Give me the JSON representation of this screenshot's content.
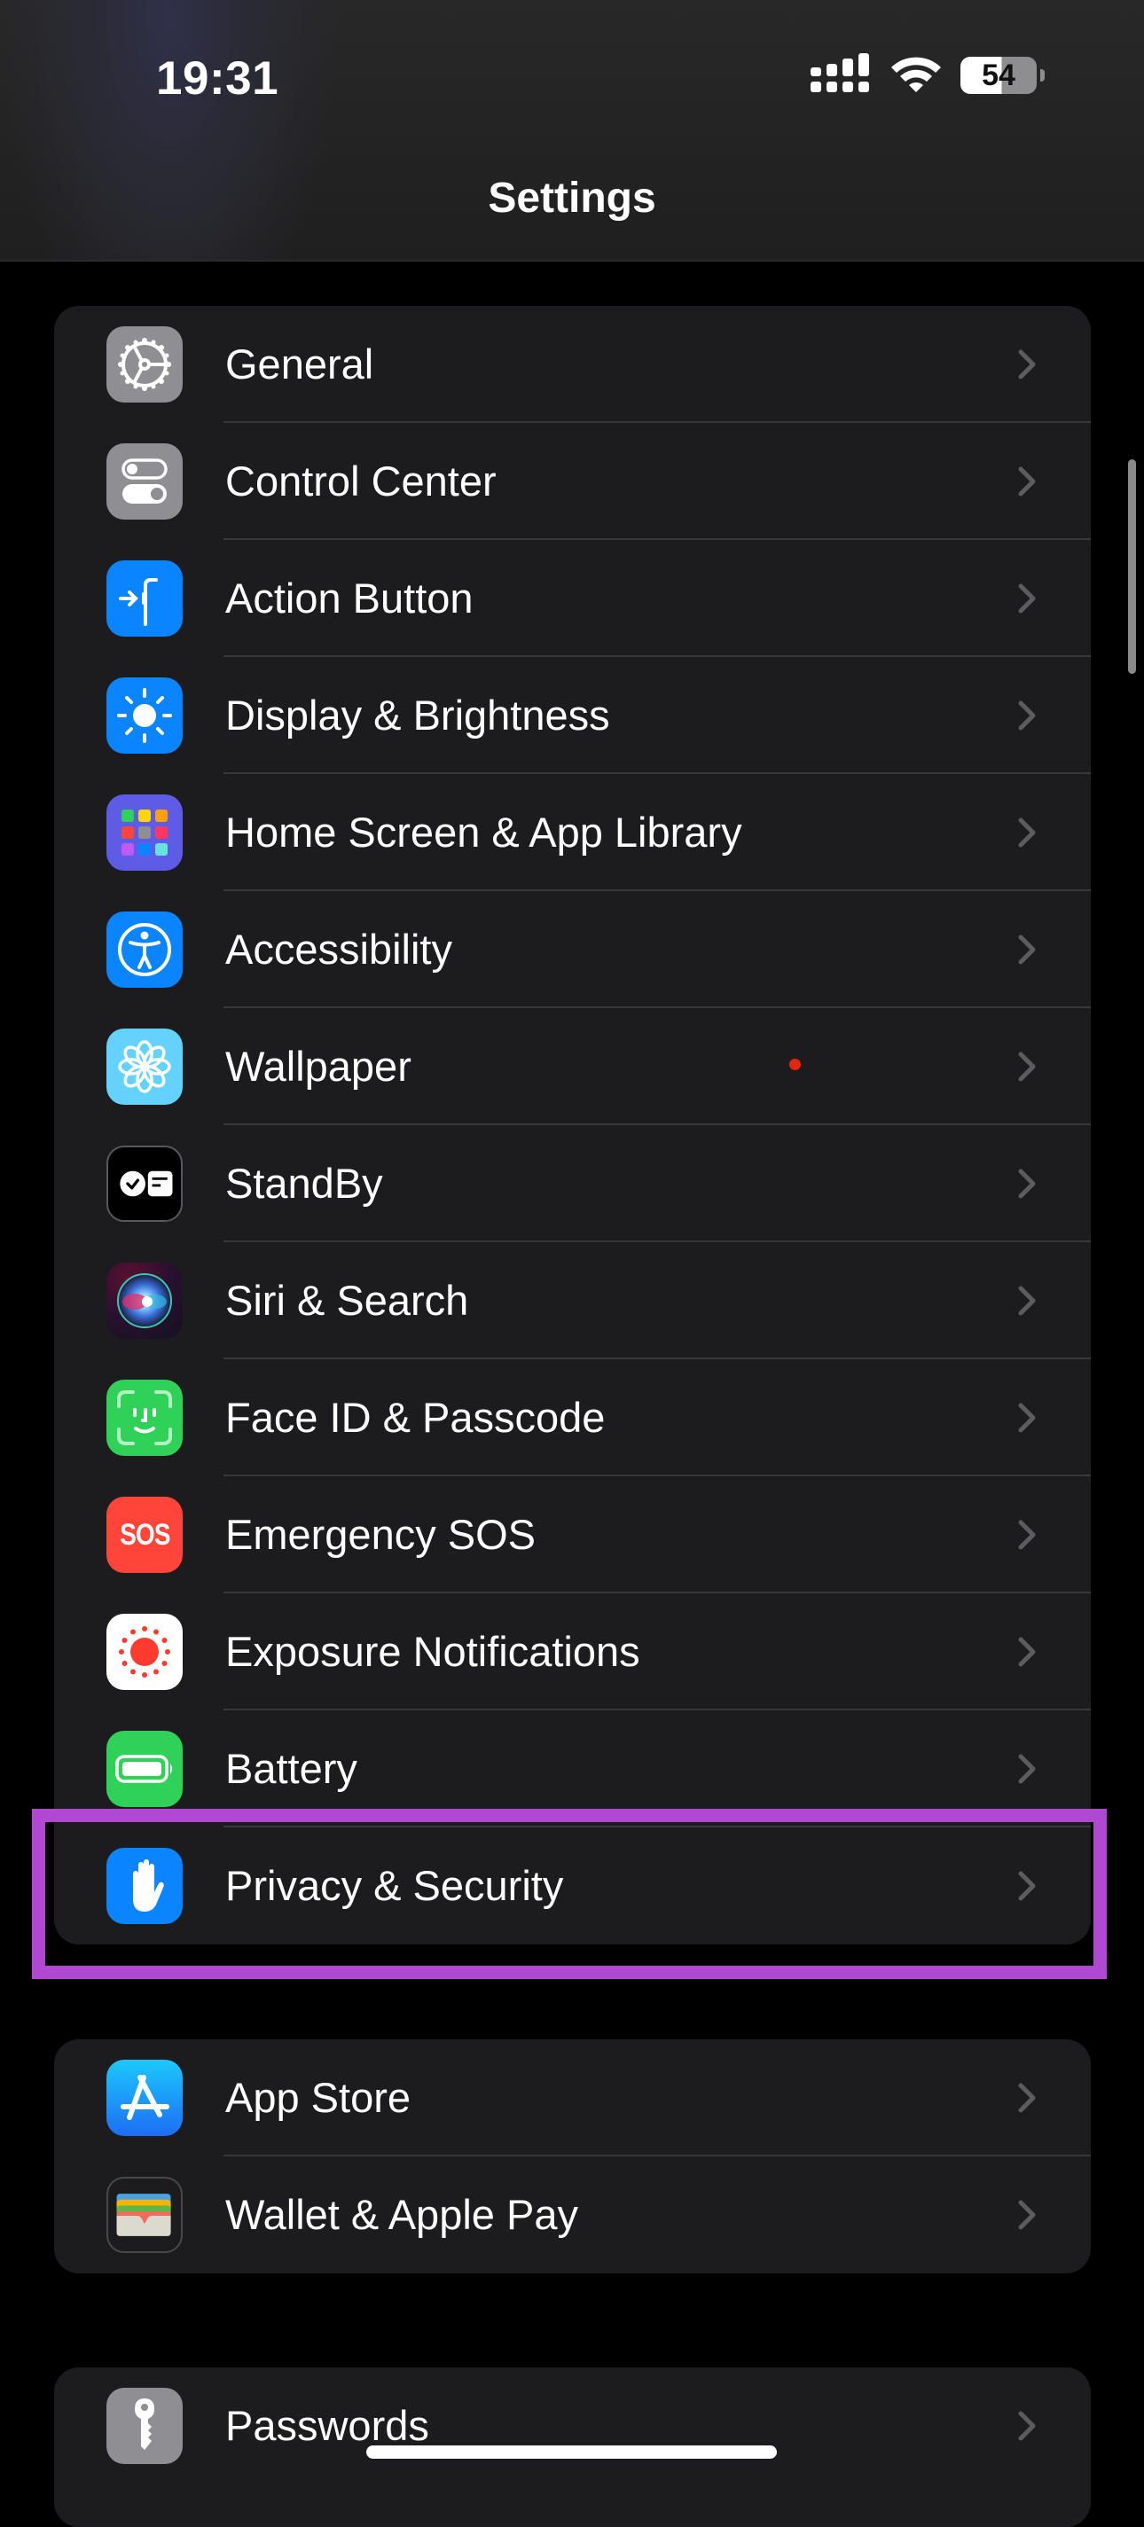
{
  "status_bar": {
    "time": "19:31",
    "signal_icon": "cellular-signal-icon",
    "wifi_icon": "wifi-icon",
    "battery_percent": "54",
    "battery_level": 0.54
  },
  "header": {
    "title": "Settings"
  },
  "groups": [
    {
      "items": [
        {
          "label": "General",
          "icon": "gear-icon",
          "color": "#8e8e93"
        },
        {
          "label": "Control Center",
          "icon": "toggles-icon",
          "color": "#8e8e93"
        },
        {
          "label": "Action Button",
          "icon": "action-button-icon",
          "color": "#0a84ff"
        },
        {
          "label": "Display & Brightness",
          "icon": "sun-icon",
          "color": "#0a84ff"
        },
        {
          "label": "Home Screen & App Library",
          "icon": "app-grid-icon",
          "color": "#5e5ce6"
        },
        {
          "label": "Accessibility",
          "icon": "accessibility-icon",
          "color": "#0a84ff"
        },
        {
          "label": "Wallpaper",
          "icon": "flower-icon",
          "color": "#64d2ff",
          "badge": "red-dot"
        },
        {
          "label": "StandBy",
          "icon": "standby-icon",
          "color": "#000000"
        },
        {
          "label": "Siri & Search",
          "icon": "siri-icon",
          "color": "#1a1a2e"
        },
        {
          "label": "Face ID & Passcode",
          "icon": "face-id-icon",
          "color": "#30d158"
        },
        {
          "label": "Emergency SOS",
          "icon": "sos-icon",
          "color": "#ff453a",
          "icon_text": "SOS"
        },
        {
          "label": "Exposure Notifications",
          "icon": "exposure-icon",
          "color": "#ffffff"
        },
        {
          "label": "Battery",
          "icon": "battery-icon",
          "color": "#30d158"
        },
        {
          "label": "Privacy & Security",
          "icon": "hand-icon",
          "color": "#0a84ff",
          "highlighted": true
        }
      ]
    },
    {
      "items": [
        {
          "label": "App Store",
          "icon": "app-store-icon",
          "color": "#1e90ff"
        },
        {
          "label": "Wallet & Apple Pay",
          "icon": "wallet-icon",
          "color": "#1c1c1e"
        }
      ]
    },
    {
      "items": [
        {
          "label": "Passwords",
          "icon": "key-icon",
          "color": "#8e8e93"
        }
      ]
    }
  ],
  "highlight_color": "#b048d4",
  "chevron_icon": "chevron-right-icon"
}
